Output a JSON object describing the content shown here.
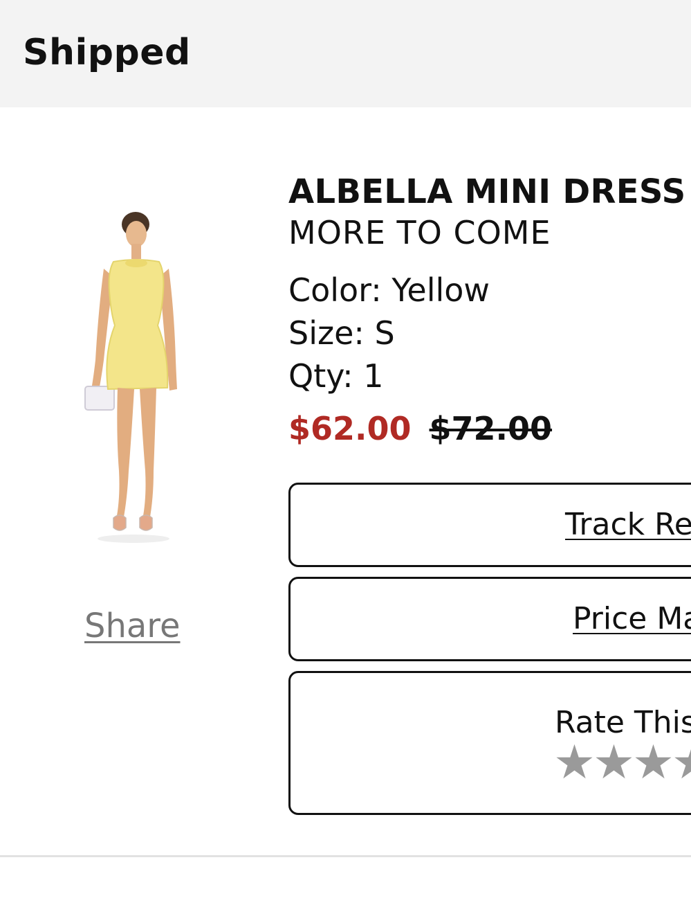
{
  "header": {
    "status": "Shipped"
  },
  "product": {
    "name": "ALBELLA MINI DRESS",
    "brand": "MORE TO COME",
    "color_label": "Color: Yellow",
    "size_label": "Size: S",
    "qty_label": "Qty: 1",
    "sale_price": "$62.00",
    "original_price": "$72.00",
    "share_label": "Share",
    "image_icon": "yellow-mini-dress-photo"
  },
  "actions": {
    "track_label": "Track Return",
    "price_match_label": "Price Match",
    "rate_label": "Rate This Item",
    "rating": {
      "value": 0,
      "max": 5,
      "star_color": "#9a9a9a"
    }
  },
  "colors": {
    "header_bg": "#f3f3f3",
    "sale_price": "#b02a24",
    "muted_text": "#777777"
  }
}
